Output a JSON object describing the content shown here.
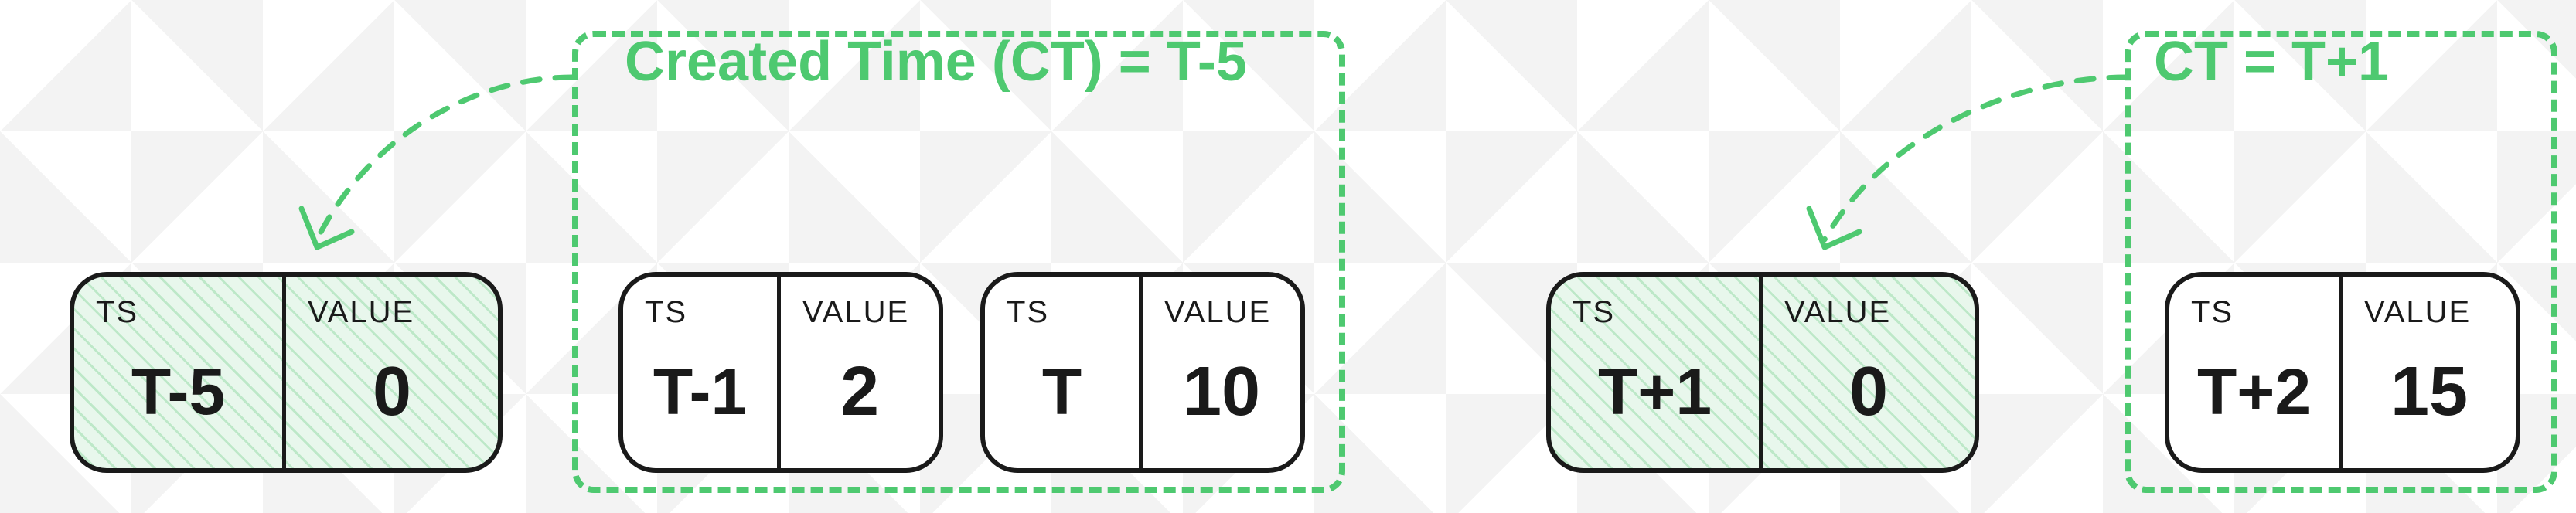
{
  "headers": {
    "ts": "TS",
    "value": "VALUE"
  },
  "groups": [
    {
      "label": "Created Time (CT) = T-5"
    },
    {
      "label": "CT = T+1"
    }
  ],
  "tiles": [
    {
      "ts": "T-5",
      "value": "0",
      "hatched": true
    },
    {
      "ts": "T-1",
      "value": "2",
      "hatched": false
    },
    {
      "ts": "T",
      "value": "10",
      "hatched": false
    },
    {
      "ts": "T+1",
      "value": "0",
      "hatched": true
    },
    {
      "ts": "T+2",
      "value": "15",
      "hatched": false
    }
  ]
}
